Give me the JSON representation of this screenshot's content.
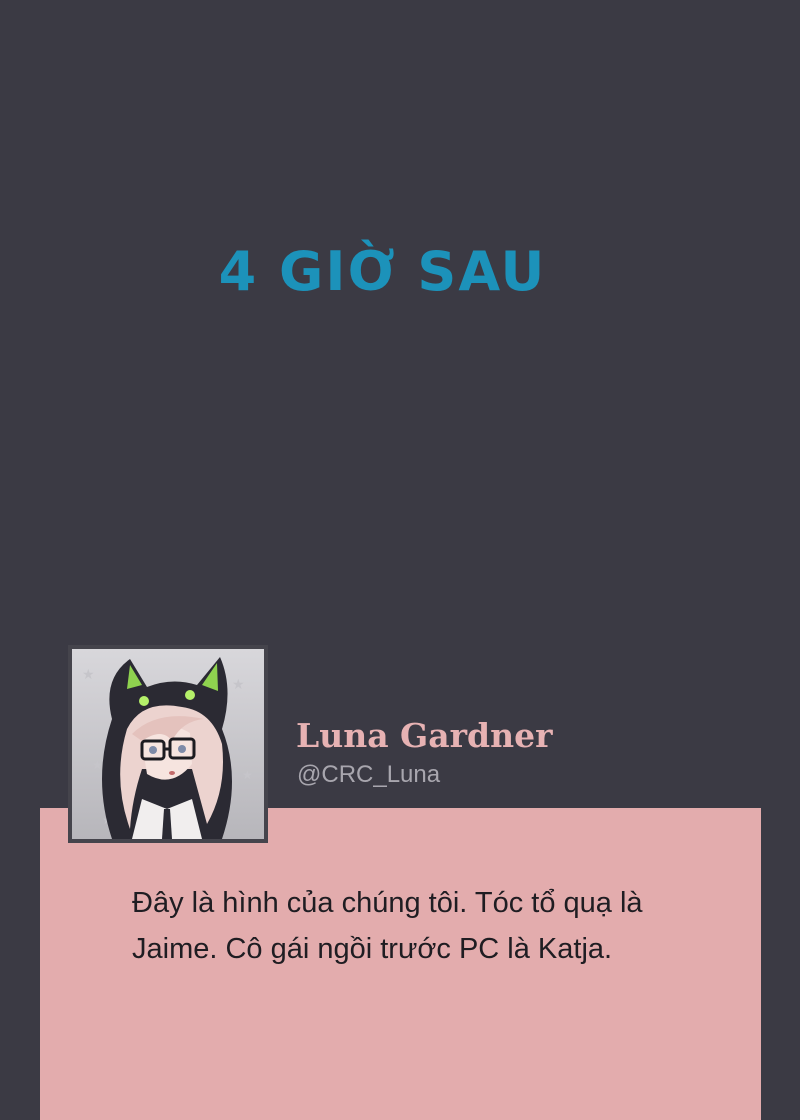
{
  "caption": "4 GIỜ SAU",
  "post": {
    "author_name": "Luna Gardner",
    "author_handle": "@CRC_Luna",
    "body": "Đây là hình của chúng tôi. Tóc tổ quạ là Jaime. Cô gái ngồi trước PC là  Katja."
  },
  "colors": {
    "background": "#3b3a44",
    "caption": "#1c92ba",
    "card": "#e3acad",
    "name": "#e7b2b3",
    "handle": "#a8a6ae"
  },
  "icons": {
    "avatar": "anime-girl-cat-hood-avatar"
  }
}
